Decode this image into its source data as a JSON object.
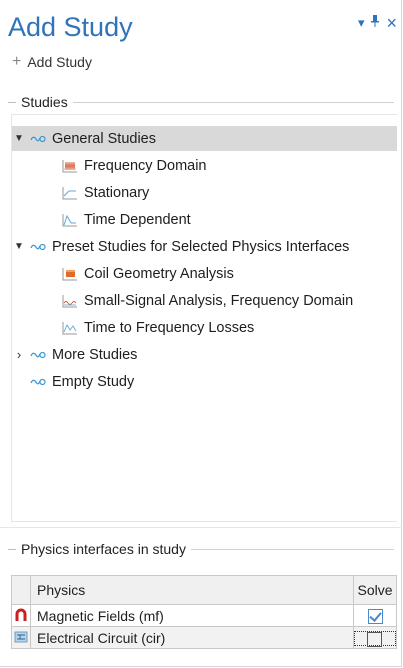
{
  "title": "Add Study",
  "window_controls": {
    "menu": "▾",
    "pin": "⊥",
    "close": "×"
  },
  "add_study_label": "Add Study",
  "studies_header": "Studies",
  "tree": {
    "general": {
      "label": "General Studies",
      "children": [
        "Frequency Domain",
        "Stationary",
        "Time Dependent"
      ]
    },
    "preset": {
      "label": "Preset Studies for Selected Physics Interfaces",
      "children": [
        "Coil Geometry Analysis",
        "Small-Signal Analysis, Frequency Domain",
        "Time to Frequency Losses"
      ]
    },
    "more": {
      "label": "More Studies"
    },
    "empty": {
      "label": "Empty Study"
    }
  },
  "physics_header": "Physics interfaces in study",
  "physics_table": {
    "col_physics": "Physics",
    "col_solve": "Solve",
    "rows": [
      {
        "name": "Magnetic Fields (mf)",
        "solve": true,
        "icon": "magnet-icon"
      },
      {
        "name": "Electrical Circuit (cir)",
        "solve": false,
        "icon": "circuit-icon"
      }
    ]
  },
  "colors": {
    "accent": "#2f73ba",
    "selection": "#d9d9d9",
    "magnet": "#cc1f1f"
  }
}
